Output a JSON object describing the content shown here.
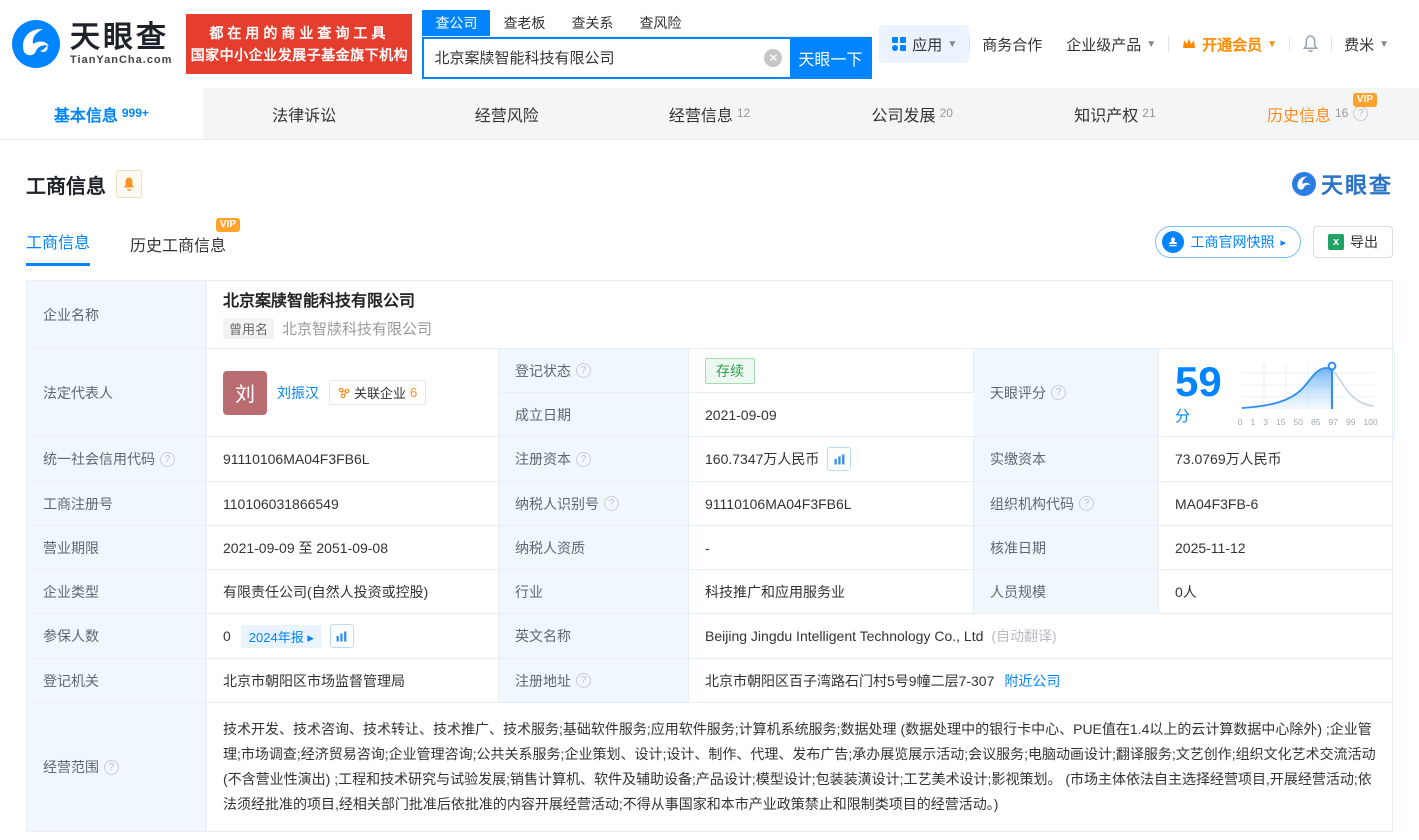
{
  "colors": {
    "accent": "#0084ff",
    "orange": "#ff8c1a",
    "green": "#30a14e",
    "red": "#e53d2e"
  },
  "header": {
    "logo_title": "天眼查",
    "logo_sub": "TianYanCha.com",
    "promo_line1": "都在用的商业查询工具",
    "promo_line2": "国家中小企业发展子基金旗下机构",
    "search_tabs": [
      {
        "label": "查公司"
      },
      {
        "label": "查老板"
      },
      {
        "label": "查关系"
      },
      {
        "label": "查风险"
      }
    ],
    "search": {
      "value": "北京案牍智能科技有限公司",
      "button": "天眼一下"
    },
    "menu": {
      "apps": "应用",
      "cooperation": "商务合作",
      "enterprise": "企业级产品",
      "vip": "开通会员",
      "user": "费米"
    }
  },
  "nav_tabs": [
    {
      "label": "基本信息",
      "count": "999+"
    },
    {
      "label": "法律诉讼",
      "count": ""
    },
    {
      "label": "经营风险",
      "count": ""
    },
    {
      "label": "经营信息",
      "count": "12"
    },
    {
      "label": "公司发展",
      "count": "20"
    },
    {
      "label": "知识产权",
      "count": "21"
    },
    {
      "label": "历史信息",
      "count": "16",
      "vip": "VIP"
    }
  ],
  "section": {
    "title": "工商信息",
    "watermark": "天眼查",
    "subtab_current": "工商信息",
    "subtab_history": "历史工商信息",
    "subtab_history_vip": "VIP",
    "snapshot_button": "工商官网快照",
    "export_button": "导出"
  },
  "company": {
    "name_label": "企业名称",
    "name": "北京案牍智能科技有限公司",
    "former_badge": "曾用名",
    "former_name": "北京智牍科技有限公司",
    "legal_rep_label": "法定代表人",
    "legal_rep_avatar": "刘",
    "legal_rep_name": "刘振汉",
    "related_label": "关联企业",
    "related_count": "6"
  },
  "fields": {
    "reg_status": {
      "label": "登记状态",
      "value": "存续"
    },
    "establish_date": {
      "label": "成立日期",
      "value": "2021-09-09"
    },
    "score": {
      "label": "天眼评分",
      "value": "59",
      "unit": "分"
    },
    "credit_code": {
      "label": "统一社会信用代码",
      "value": "91110106MA04F3FB6L"
    },
    "reg_capital": {
      "label": "注册资本",
      "value": "160.7347万人民币"
    },
    "paid_capital": {
      "label": "实缴资本",
      "value": "73.0769万人民币"
    },
    "reg_number": {
      "label": "工商注册号",
      "value": "110106031866549"
    },
    "taxpayer_id": {
      "label": "纳税人识别号",
      "value": "91110106MA04F3FB6L"
    },
    "org_code": {
      "label": "组织机构代码",
      "value": "MA04F3FB-6"
    },
    "business_term": {
      "label": "营业期限",
      "value": "2021-09-09 至 2051-09-08"
    },
    "taxpayer_qualification": {
      "label": "纳税人资质",
      "value": "-"
    },
    "approval_date": {
      "label": "核准日期",
      "value": "2025-11-12"
    },
    "company_type": {
      "label": "企业类型",
      "value": "有限责任公司(自然人投资或控股)"
    },
    "industry": {
      "label": "行业",
      "value": "科技推广和应用服务业"
    },
    "staff_size": {
      "label": "人员规模",
      "value": "0人"
    },
    "insured_count": {
      "label": "参保人数",
      "value": "0",
      "badge": "2024年报 ▸"
    },
    "english_name": {
      "label": "英文名称",
      "value": "Beijing Jingdu Intelligent Technology Co., Ltd",
      "note": "(自动翻译)"
    },
    "reg_authority": {
      "label": "登记机关",
      "value": "北京市朝阳区市场监督管理局"
    },
    "reg_address": {
      "label": "注册地址",
      "value": "北京市朝阳区百子湾路石门村5号9幢二层7-307",
      "link": "附近公司"
    },
    "business_scope": {
      "label": "经营范围",
      "value": "技术开发、技术咨询、技术转让、技术推广、技术服务;基础软件服务;应用软件服务;计算机系统服务;数据处理 (数据处理中的银行卡中心、PUE值在1.4以上的云计算数据中心除外) ;企业管理;市场调查;经济贸易咨询;企业管理咨询;公共关系服务;企业策划、设计;设计、制作、代理、发布广告;承办展览展示活动;会议服务;电脑动画设计;翻译服务;文艺创作;组织文化艺术交流活动 (不含营业性演出) ;工程和技术研究与试验发展;销售计算机、软件及辅助设备;产品设计;模型设计;包装装潢设计;工艺美术设计;影视策划。 (市场主体依法自主选择经营项目,开展经营活动;依法须经批准的项目,经相关部门批准后依批准的内容开展经营活动;不得从事国家和本市产业政策禁止和限制类项目的经营活动。)"
    }
  },
  "score_chart": {
    "type": "area",
    "description": "score distribution bell curve with marker at company score",
    "score": 59,
    "ticks": [
      "0",
      "1",
      "3",
      "15",
      "50",
      "85",
      "97",
      "99",
      "100"
    ]
  }
}
